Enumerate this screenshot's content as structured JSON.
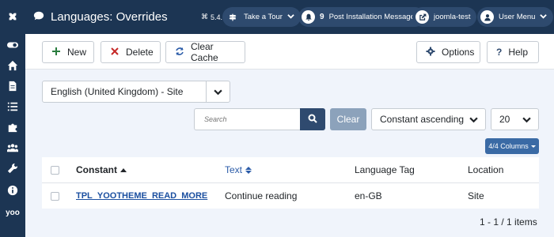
{
  "header": {
    "title": "Languages: Overrides",
    "version": "5.4.1",
    "take_tour": "Take a Tour",
    "messages_count": "9",
    "messages_label": "Post Installation Messages",
    "site_label": "joomla-test",
    "user_menu": "User Menu"
  },
  "sidebar": {
    "icons": [
      "joomla-logo-icon",
      "toggle-icon",
      "home-icon",
      "file-icon",
      "list-icon",
      "puzzle-icon",
      "users-icon",
      "wrench-icon",
      "info-icon",
      "yoo-icon"
    ],
    "yoo_text": "yoo"
  },
  "toolbar": {
    "new_label": "New",
    "delete_label": "Delete",
    "clear_cache_label": "Clear Cache",
    "options_label": "Options",
    "help_label": "Help"
  },
  "filters": {
    "language_select": "English (United Kingdom) - Site",
    "search_placeholder": "Search",
    "clear_label": "Clear",
    "sort_select": "Constant ascending",
    "limit_select": "20",
    "columns_label": "4/4 Columns"
  },
  "table": {
    "headers": {
      "constant": "Constant",
      "text": "Text",
      "language_tag": "Language Tag",
      "location": "Location"
    },
    "rows": [
      {
        "constant": "TPL_YOOTHEME_READ_MORE",
        "text": "Continue reading",
        "language_tag": "en-GB",
        "location": "Site"
      }
    ]
  },
  "pagination": {
    "info": "1 - 1 / 1 items"
  },
  "colors": {
    "header_bg": "#1c3553",
    "page_bg": "#f0f4fb",
    "primary": "#2f4a6f",
    "link": "#2a5ba8",
    "new_icon": "#2a7d3f",
    "delete_icon": "#c52827"
  }
}
